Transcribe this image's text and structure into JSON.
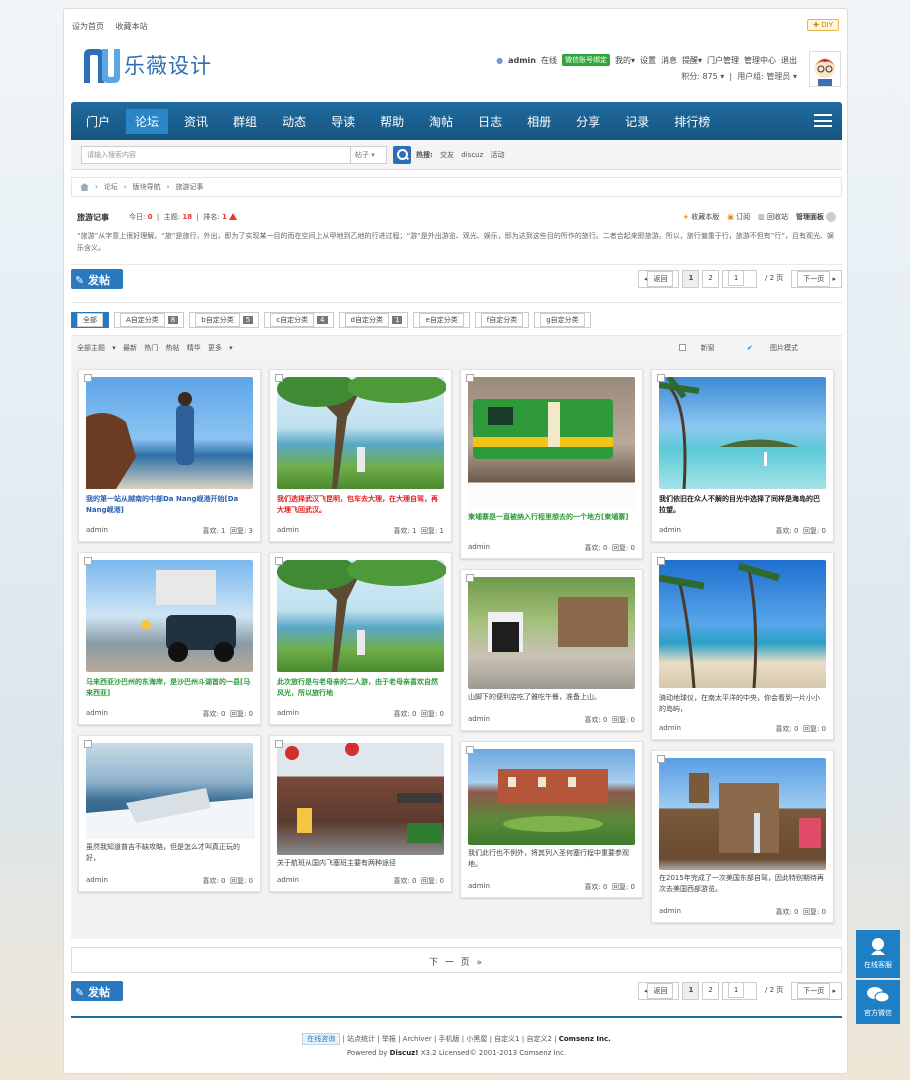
{
  "topbar": {
    "set_home": "设为首页",
    "bookmark": "收藏本站",
    "diy": "DIY"
  },
  "logo": {
    "text": "乐薇设计"
  },
  "user": {
    "name": "admin",
    "online": "在线",
    "wechat_bind": "微信账号绑定",
    "my": "我的",
    "settings": "设置",
    "messages": "消息",
    "remind": "提醒",
    "portal": "门户管理",
    "admin_center": "管理中心",
    "logout": "退出",
    "points": "积分: 875",
    "group": "用户组: 管理员"
  },
  "nav": {
    "items": [
      "门户",
      "论坛",
      "资讯",
      "群组",
      "动态",
      "导读",
      "帮助",
      "淘帖",
      "日志",
      "相册",
      "分享",
      "记录",
      "排行榜"
    ],
    "active": 1
  },
  "search": {
    "placeholder": "请输入搜索内容",
    "scope": "帖子",
    "hot_label": "热搜:",
    "hot": [
      "交友",
      "discuz",
      "活动"
    ]
  },
  "breadcrumb": [
    "论坛",
    "版块导航",
    "旅游记事"
  ],
  "forum": {
    "name": "旅游记事",
    "today_label": "今日:",
    "today": "0",
    "topics_label": "主题:",
    "topics": "18",
    "rank_label": "排名:",
    "rank": "1",
    "actions": [
      "收藏本版",
      "订阅",
      "回收站",
      "管理面板"
    ],
    "description": "“旅游”从字意上很好理解。“旅”是旅行，外出，即为了实现某一目的而在空间上从甲地到乙地的行进过程；“游”是外出游览、观光、娱乐，即为达到这些目的所作的旅行。二者合起来即旅游。所以，旅行偏重于行，旅游不但有“行”，且有观光、娱乐含义。"
  },
  "post_button": "发帖",
  "pager": {
    "back": "返回",
    "pages": [
      "1",
      "2"
    ],
    "input": "1",
    "total": "/ 2 页",
    "next": "下一页"
  },
  "tabs": [
    {
      "label": "全部",
      "count": ""
    },
    {
      "label": "A自定分类",
      "count": "8"
    },
    {
      "label": "b自定分类",
      "count": "5"
    },
    {
      "label": "c自定分类",
      "count": "4"
    },
    {
      "label": "d自定分类",
      "count": "1"
    },
    {
      "label": "e自定分类",
      "count": ""
    },
    {
      "label": "f自定分类",
      "count": ""
    },
    {
      "label": "g自定分类",
      "count": ""
    }
  ],
  "filter": {
    "all_topics": "全部主题",
    "latest": "最新",
    "hot": "热门",
    "hot_posts": "热帖",
    "digest": "精华",
    "more": "更多",
    "new_window": "新窗",
    "image_mode": "图片模式"
  },
  "cards": [
    {
      "title": "我的第一站从越南的中部Da Nang岘港开始[Da Nang岘港]",
      "title_color": "#2a5fb0",
      "author": "admin",
      "likes": "喜欢: 1",
      "replies": "回复: 3"
    },
    {
      "title": "我们选择武汉飞昆明，包车去大理，在大理自驾，再大理飞回武汉。",
      "title_color": "#e02020",
      "author": "admin",
      "likes": "喜欢: 1",
      "replies": "回复: 1"
    },
    {
      "title": "柬埔寨是一直被纳入行程里想去的一个地方[柬埔寨]",
      "title_color": "#2f9a3a",
      "author": "admin",
      "likes": "喜欢: 0",
      "replies": "回复: 0"
    },
    {
      "title": "我们依旧在众人不解的目光中选择了同样是海岛的巴拉望。",
      "title_color": "#222222",
      "author": "admin",
      "likes": "喜欢: 0",
      "replies": "回复: 0"
    },
    {
      "title": "马来西亚沙巴州的东海岸，是沙巴州斗湖首的一县[马来西亚]",
      "title_color": "#2f9a3a",
      "author": "admin",
      "likes": "喜欢: 0",
      "replies": "回复: 0"
    },
    {
      "title": "此次旅行是与老母亲的二人游，由于老母亲喜欢自然风光，所以旅行地",
      "title_color": "#2f9a3a",
      "author": "admin",
      "likes": "喜欢: 0",
      "replies": "回复: 0"
    },
    {
      "title": "山脚下的便利店吃了雅吃午餐，准备上山。",
      "title_color": "#444444",
      "author": "admin",
      "likes": "喜欢: 0",
      "replies": "回复: 0"
    },
    {
      "title": "骑动地球仪，在南太平洋的中央，你会看到一片小小的岛屿，",
      "title_color": "#444444",
      "author": "admin",
      "likes": "喜欢: 0",
      "replies": "回复: 0"
    },
    {
      "title": "虽然我知道普吉不缺攻略，但是怎么才叫真正玩的好，",
      "title_color": "#444444",
      "author": "admin",
      "likes": "喜欢: 0",
      "replies": "回复: 0"
    },
    {
      "title": "关于航班从国内飞塞班主要有两种途径",
      "title_color": "#444444",
      "author": "admin",
      "likes": "喜欢: 0",
      "replies": "回复: 0"
    },
    {
      "title": "我们此行也不例外，将其列入圣何塞行程中重要参观地。",
      "title_color": "#444444",
      "author": "admin",
      "likes": "喜欢: 0",
      "replies": "回复: 0"
    },
    {
      "title": "在2015年完成了一次美国东部自驾，因此特别期待再次去美国西部游览。",
      "title_color": "#444444",
      "author": "admin",
      "likes": "喜欢: 0",
      "replies": "回复: 0"
    }
  ],
  "next_page": "下 一 页  »",
  "footer": {
    "chat": "在线咨询",
    "links": [
      "站点统计",
      "举报",
      "Archiver",
      "手机版",
      "小黑屋",
      "自定义1",
      "自定义2"
    ],
    "company": "Comsenz Inc.",
    "powered": "Powered by",
    "brand": "Discuz!",
    "version": "X3.2 Licensed© 2001-2013 Comsenz Inc."
  },
  "side": {
    "service": "在线客服",
    "wechat": "官方微信"
  }
}
